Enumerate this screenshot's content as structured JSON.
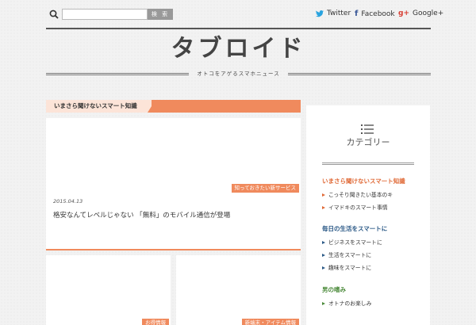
{
  "header": {
    "search": {
      "value": "",
      "placeholder": "",
      "button_label": "検 索"
    },
    "social": [
      {
        "label": "Twitter",
        "icon": "twitter-icon"
      },
      {
        "label": "Facebook",
        "icon": "facebook-icon"
      },
      {
        "label": "Google+",
        "icon": "google-plus-icon"
      }
    ],
    "logo": "タブロイド",
    "tagline": "オトコをアゲるスマホニュース"
  },
  "main": {
    "section_title": "いまさら聞けないスマート知識",
    "featured": {
      "category": "知っておきたい新サービス",
      "date": "2015.04.13",
      "title": "格安なんてレベルじゃない 「無料」のモバイル通信が登場"
    },
    "cards": [
      {
        "category": "お得情報"
      },
      {
        "category": "新端末・アイテム情報"
      }
    ]
  },
  "sidebar": {
    "title": "カテゴリー",
    "groups": [
      {
        "heading": "いまさら聞けないスマート知識",
        "color": "#e06a37",
        "items": [
          "こっそり聞きたい基本のキ",
          "イマドキのスマート事情"
        ]
      },
      {
        "heading": "毎日の生活をスマートに",
        "color": "#2c5a87",
        "items": [
          "ビジネスをスマートに",
          "生活をスマートに",
          "趣味をスマートに"
        ]
      },
      {
        "heading": "男の嗜み",
        "color": "#4b8a3a",
        "items": [
          "オトナのお楽しみ"
        ]
      }
    ]
  },
  "colors": {
    "accent": "#f08a5d",
    "accent_light": "#fce4d8"
  }
}
